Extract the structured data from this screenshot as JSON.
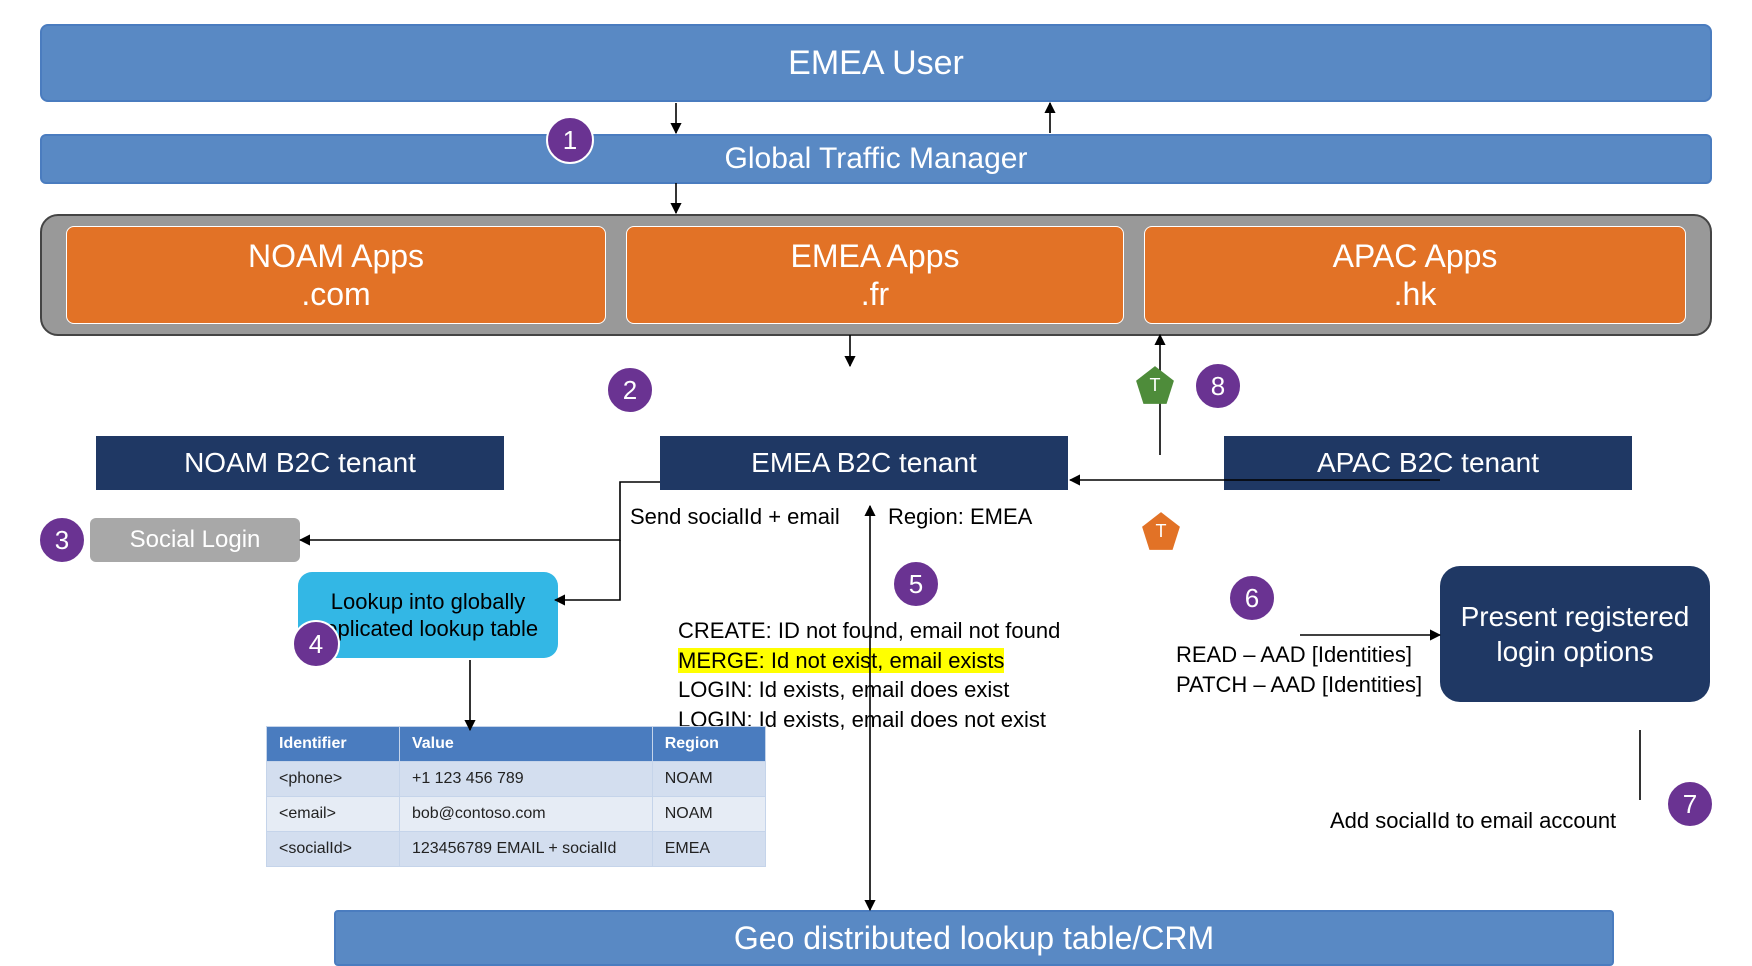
{
  "header": {
    "user": "EMEA User",
    "gtm": "Global Traffic Manager"
  },
  "apps": {
    "noam": {
      "title": "NOAM Apps",
      "tld": ".com"
    },
    "emea": {
      "title": "EMEA Apps",
      "tld": ".fr"
    },
    "apac": {
      "title": "APAC Apps",
      "tld": ".hk"
    }
  },
  "tenants": {
    "noam": "NOAM B2C tenant",
    "emea": "EMEA B2C tenant",
    "apac": "APAC B2C tenant"
  },
  "social_login": "Social Login",
  "lookup_box": "Lookup into globally replicated lookup table",
  "lookup_table": {
    "headers": [
      "Identifier",
      "Value",
      "Region"
    ],
    "rows": [
      [
        "<phone>",
        "+1 123 456 789",
        "NOAM"
      ],
      [
        "<email>",
        "bob@contoso.com",
        "NOAM"
      ],
      [
        "<socialId>",
        "123456789 EMAIL + socialId",
        "EMEA"
      ]
    ]
  },
  "labels": {
    "send": "Send socialId + email",
    "region": "Region: EMEA",
    "decision_create": "CREATE: ID not found, email not found",
    "decision_merge": "MERGE: Id not exist, email exists",
    "decision_login1": "LOGIN: Id exists, email does exist",
    "decision_login2": "LOGIN: Id exists, email does not exist",
    "aad_read": "READ – AAD [Identities]",
    "aad_patch": "PATCH – AAD [Identities]",
    "add_social": "Add socialId to email account"
  },
  "present_box": "Present registered login options",
  "footer": "Geo distributed lookup table/CRM",
  "steps": {
    "1": "1",
    "2": "2",
    "3": "3",
    "4": "4",
    "5": "5",
    "6": "6",
    "7": "7",
    "8": "8"
  },
  "token_label": "T"
}
